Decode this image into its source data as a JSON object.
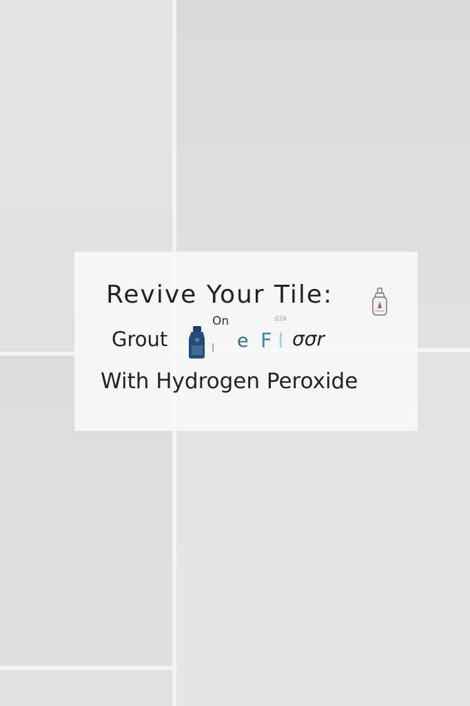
{
  "background": {
    "tile_color": "#e4e4e4",
    "grout_color": "#f4f4f4"
  },
  "card": {
    "background": "#f7f7f7",
    "line1": "Revive Your Tile:",
    "line2_word": "Grout",
    "line2_small_on": "On",
    "line2_small_scribble": "d2k",
    "line2_glyph_a": "ı",
    "line2_glyph_e": "e",
    "line2_glyph_f": "F",
    "line2_glyph_i": "I",
    "line2_glyph_oor": "σσr",
    "line3": "With Hydrogen Peroxide",
    "icons": [
      "spray-bottle-icon",
      "cleaner-bottle-icon"
    ]
  }
}
